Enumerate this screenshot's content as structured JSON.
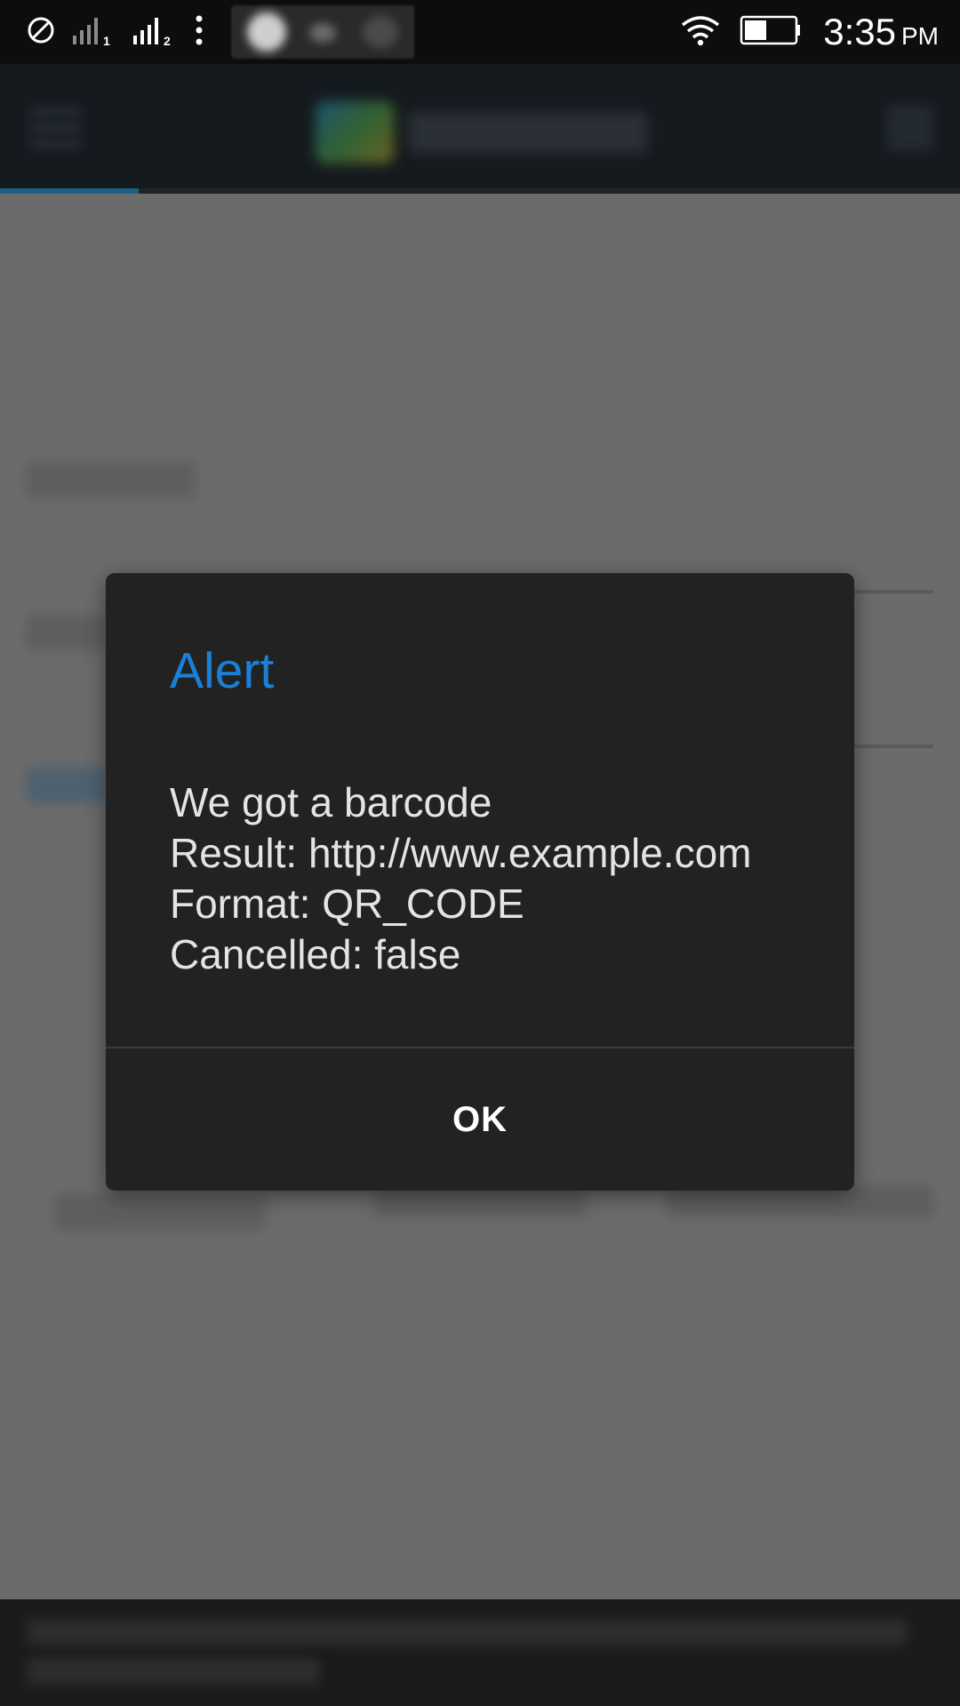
{
  "status_bar": {
    "time": "3:35",
    "ampm": "PM",
    "icons": [
      "do-not-disturb-icon",
      "signal-sim1-icon",
      "signal-sim2-icon",
      "more-vert-icon",
      "wifi-icon",
      "battery-icon"
    ],
    "sim1_label": "1",
    "sim2_label": "2"
  },
  "dialog": {
    "title": "Alert",
    "message_lines": [
      "We got a barcode",
      "Result: http://www.example.com",
      "Format: QR_CODE",
      "Cancelled: false"
    ],
    "ok_label": "OK"
  },
  "colors": {
    "accent": "#1a7fd6",
    "dialog_bg": "#222222",
    "scrim": "#6b6b6b"
  }
}
